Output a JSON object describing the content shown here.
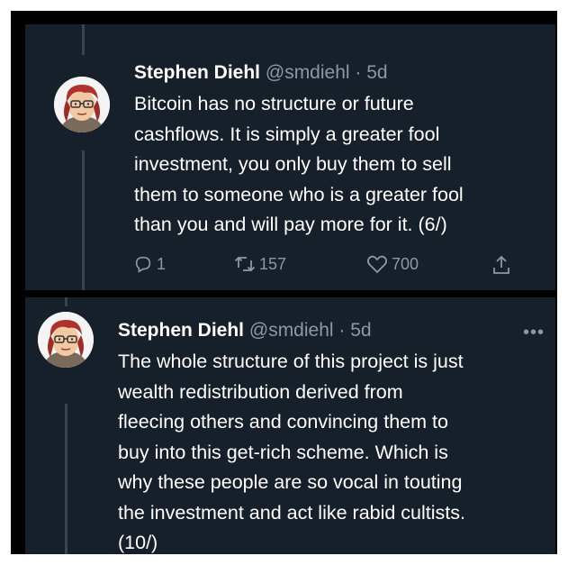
{
  "tweets": [
    {
      "name": "Stephen Diehl",
      "handle": "@smdiehl",
      "time": "· 5d",
      "lines": [
        "Bitcoin has no structure or future",
        "cashflows. It is simply a greater fool",
        "investment, you only buy them to sell",
        "them to someone who is a greater fool",
        "than you and will pay more for it. (6/)"
      ],
      "actions": {
        "reply": "1",
        "retweet": "157",
        "like": "700"
      }
    },
    {
      "name": "Stephen Diehl",
      "handle": "@smdiehl",
      "time": "· 5d",
      "more": "•••",
      "lines": [
        "The whole structure of this project is just",
        "wealth redistribution derived from",
        "fleecing others and convincing them to",
        "buy into this get-rich scheme. Which is",
        "why these people are so vocal in touting",
        "the investment and act like rabid cultists.",
        "(10/)"
      ]
    }
  ],
  "icons": {
    "reply": "reply-icon",
    "retweet": "retweet-icon",
    "like": "heart-icon",
    "share": "share-icon"
  },
  "colors": {
    "background": "#15202b",
    "text": "#ffffff",
    "muted": "#8b98a5",
    "thread_line": "#38444d"
  }
}
